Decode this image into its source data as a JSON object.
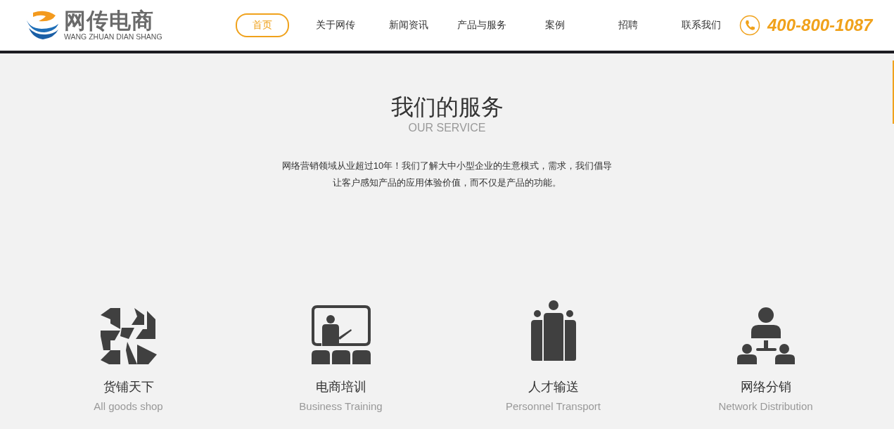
{
  "logo": {
    "name": "网传电商",
    "pinyin": "WANG ZHUAN DIAN SHANG"
  },
  "nav": [
    {
      "label": "首页",
      "selected": true
    },
    {
      "label": "关于网传",
      "selected": false
    },
    {
      "label": "新闻资讯",
      "selected": false
    },
    {
      "label": "产品与服务",
      "selected": false
    },
    {
      "label": "案例",
      "selected": false
    },
    {
      "label": "招聘",
      "selected": false
    },
    {
      "label": "联系我们",
      "selected": false
    }
  ],
  "hotline": "400-800-1087",
  "section": {
    "title": "我们的服务",
    "subtitle": "OUR SERVICE",
    "description": "网络营销领域从业超过10年！我们了解大中小型企业的生意模式，需求，我们倡导让客户感知产品的应用体验价值，而不仅是产品的功能。"
  },
  "services": [
    {
      "title": "货铺天下",
      "subtitle": "All goods shop"
    },
    {
      "title": "电商培训",
      "subtitle": "Business Training"
    },
    {
      "title": "人才输送",
      "subtitle": "Personnel Transport"
    },
    {
      "title": "网络分销",
      "subtitle": "Network Distribution"
    }
  ]
}
